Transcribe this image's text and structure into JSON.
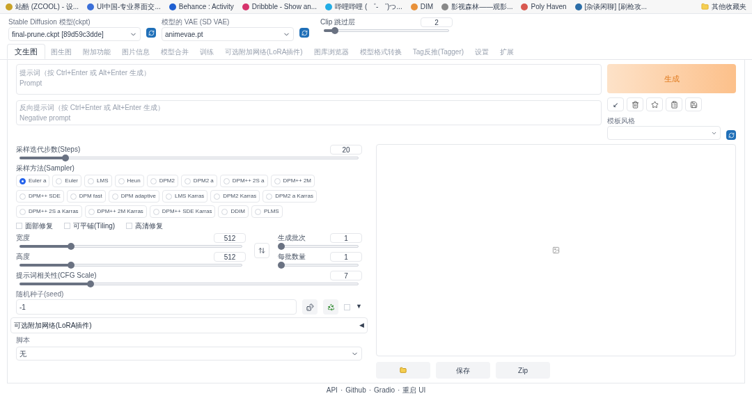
{
  "bookmarks": [
    {
      "label": "站酷 (ZCOOL) - 设...",
      "color": "#c9a227"
    },
    {
      "label": "UI中国-专业界面交...",
      "color": "#3b6fd8"
    },
    {
      "label": "Behance : Activity",
      "color": "#1f5fd1"
    },
    {
      "label": "Dribbble - Show an...",
      "color": "#d6336c"
    },
    {
      "label": "哔哩哔哩 ( ゜- ゜)つ...",
      "color": "#23ade5"
    },
    {
      "label": "DIM",
      "color": "#e8913a"
    },
    {
      "label": "影视森林——观影...",
      "color": "#888888"
    },
    {
      "label": "Poly Haven",
      "color": "#d8584f"
    },
    {
      "label": "[杂谈闲聊] [刷枪攻...",
      "color": "#2c6ea8"
    }
  ],
  "other_bookmarks": "其他收藏夹",
  "model_select": {
    "label": "Stable Diffusion 模型(ckpt)",
    "value": "final-prune.ckpt [89d59c3dde]"
  },
  "vae_select": {
    "label": "模型的 VAE (SD VAE)",
    "value": "animevae.pt"
  },
  "clip_skip": {
    "label": "Clip 跳过层",
    "value": "2",
    "level": 0.09
  },
  "tabs": [
    {
      "label": "文生图",
      "selected": true
    },
    {
      "label": "图生图",
      "selected": false
    },
    {
      "label": "附加功能",
      "selected": false
    },
    {
      "label": "图片信息",
      "selected": false
    },
    {
      "label": "模型合并",
      "selected": false
    },
    {
      "label": "训练",
      "selected": false
    },
    {
      "label": "可选附加网络(LoRA插件)",
      "selected": false
    },
    {
      "label": "图库浏览器",
      "selected": false
    },
    {
      "label": "模型格式转换",
      "selected": false
    },
    {
      "label": "Tag反推(Tagger)",
      "selected": false
    },
    {
      "label": "设置",
      "selected": false
    },
    {
      "label": "扩展",
      "selected": false
    }
  ],
  "prompt": {
    "label": "提示词（按 Ctrl+Enter 或 Alt+Enter 生成）",
    "placeholder": "Prompt"
  },
  "negative_prompt": {
    "label": "反向提示词（按 Ctrl+Enter 或 Alt+Enter 生成）",
    "placeholder": "Negative prompt"
  },
  "generate_button": "生成",
  "tool_buttons": [
    "↙"
  ],
  "style_select": {
    "label": "模板风格"
  },
  "steps": {
    "label": "采样迭代步数(Steps)",
    "value": "20",
    "level": 0.135
  },
  "sampler": {
    "label": "采样方法(Sampler)",
    "options": [
      {
        "label": "Euler a",
        "selected": true
      },
      {
        "label": "Euler",
        "selected": false
      },
      {
        "label": "LMS",
        "selected": false
      },
      {
        "label": "Heun",
        "selected": false
      },
      {
        "label": "DPM2",
        "selected": false
      },
      {
        "label": "DPM2 a",
        "selected": false
      },
      {
        "label": "DPM++ 2S a",
        "selected": false
      },
      {
        "label": "DPM++ 2M",
        "selected": false
      },
      {
        "label": "DPM++ SDE",
        "selected": false
      },
      {
        "label": "DPM fast",
        "selected": false
      },
      {
        "label": "DPM adaptive",
        "selected": false
      },
      {
        "label": "LMS Karras",
        "selected": false
      },
      {
        "label": "DPM2 Karras",
        "selected": false
      },
      {
        "label": "DPM2 a Karras",
        "selected": false
      },
      {
        "label": "DPM++ 2S a Karras",
        "selected": false
      },
      {
        "label": "DPM++ 2M Karras",
        "selected": false
      },
      {
        "label": "DPM++ SDE Karras",
        "selected": false
      },
      {
        "label": "DDIM",
        "selected": false
      },
      {
        "label": "PLMS",
        "selected": false
      }
    ]
  },
  "options": [
    {
      "label": "面部修复",
      "checked": false
    },
    {
      "label": "可平铺(Tiling)",
      "checked": false
    },
    {
      "label": "高清修复",
      "checked": false
    }
  ],
  "width": {
    "label": "宽度",
    "value": "512",
    "level": 0.23
  },
  "height": {
    "label": "高度",
    "value": "512",
    "level": 0.23
  },
  "batch_count": {
    "label": "生成批次",
    "value": "1",
    "level": 0
  },
  "batch_size": {
    "label": "每批数量",
    "value": "1",
    "level": 0
  },
  "cfg_scale": {
    "label": "提示词相关性(CFG Scale)",
    "value": "7",
    "level": 0.21
  },
  "seed": {
    "label": "随机种子(seed)",
    "value": "-1",
    "extra_checked": false,
    "toggle": "▼"
  },
  "lora_panel": {
    "title": "可选附加网络(LoRA插件)",
    "toggle": "◀"
  },
  "script": {
    "label": "脚本",
    "value": "无"
  },
  "output_buttons": [
    "保存",
    "Zip"
  ],
  "footer_links": [
    "API",
    "Github",
    "Gradio",
    "重启 UI"
  ],
  "footer_separator": "·"
}
